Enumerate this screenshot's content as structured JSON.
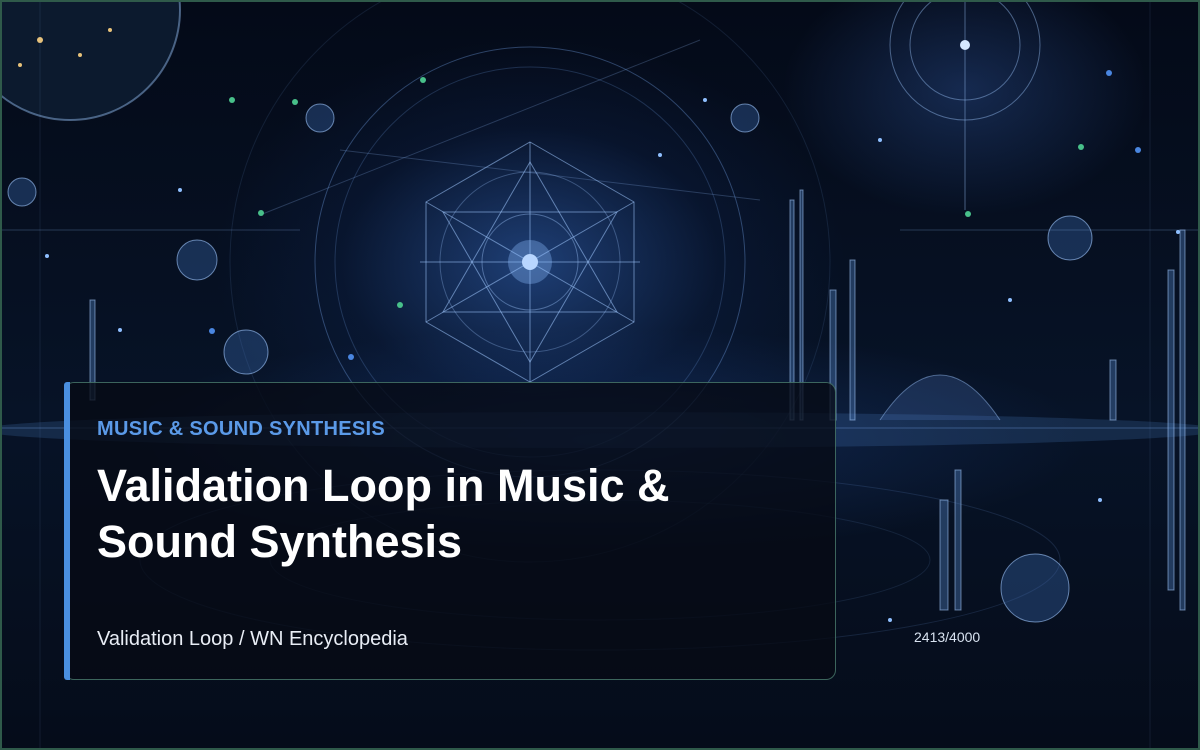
{
  "slide": {
    "category": "MUSIC & SOUND SYNTHESIS",
    "title": "Validation Loop in Music & Sound Synthesis",
    "source": "Validation Loop / WN Encyclopedia",
    "counter": "2413/4000"
  },
  "colors": {
    "accent": "#4a8fe0",
    "category_text": "#5b9ae8",
    "panel_border": "#5a9682",
    "frame": "#2f5a4a"
  },
  "background": {
    "icons": [
      "sacred-geometry-icon",
      "planet-icon",
      "orbit-ring-icon",
      "city-skyline-icon",
      "star-icon"
    ]
  }
}
